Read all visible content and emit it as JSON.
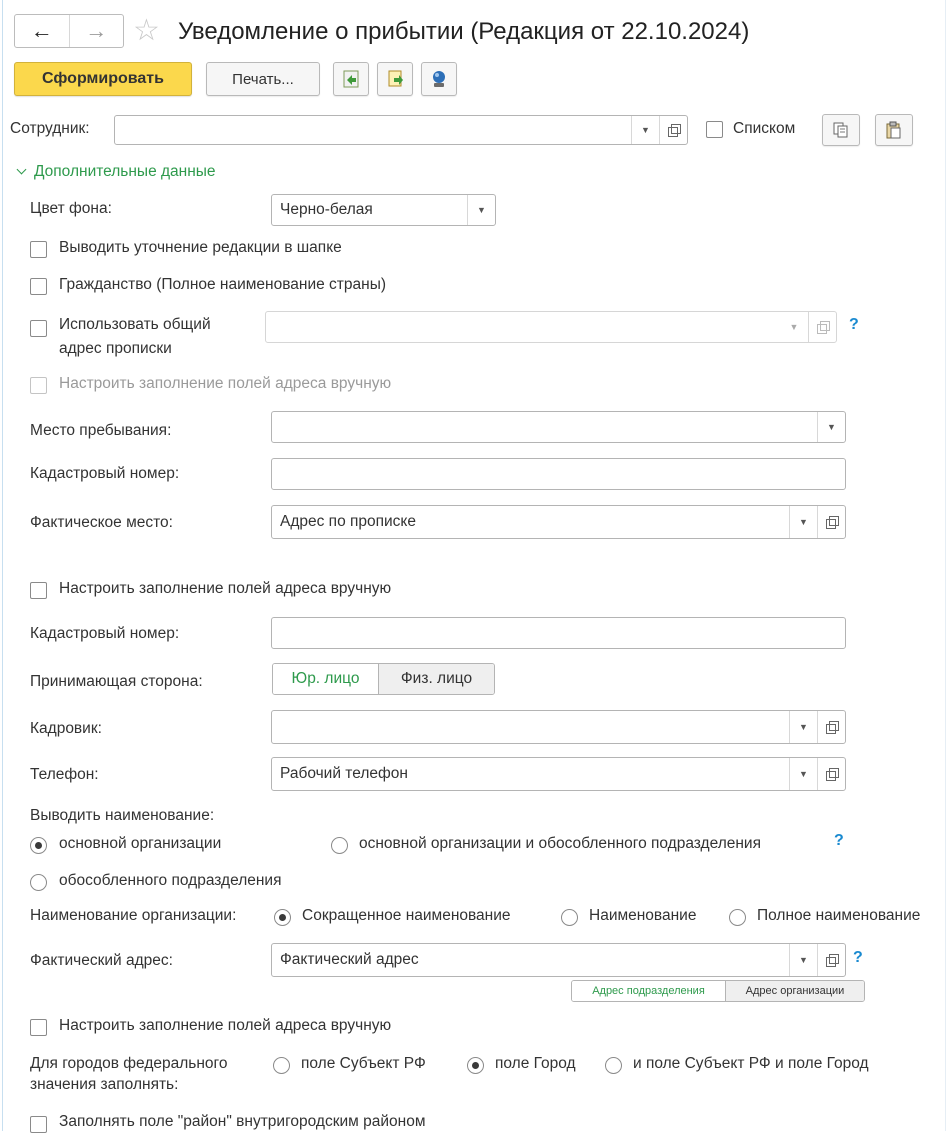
{
  "window": {
    "title": "Уведомление о прибытии (Редакция от 22.10.2024)"
  },
  "nav": {
    "back_icon": "arrow-left-icon",
    "forward_icon": "arrow-right-icon",
    "favorite_icon": "star-icon"
  },
  "toolbar": {
    "form_label": "Сформировать",
    "print_label": "Печать...",
    "icons": [
      "save-green-icon",
      "export-doc-icon",
      "settings-blue-icon"
    ]
  },
  "employee": {
    "label": "Сотрудник:",
    "value": "",
    "list_label": "Списком",
    "list_checked": false,
    "copy_icon": "copy-icon",
    "paste_icon": "paste-icon"
  },
  "extra_group": {
    "title": "Дополнительные данные",
    "expanded": true
  },
  "fields": {
    "bg_color": {
      "label": "Цвет фона:",
      "value": "Черно-белая"
    },
    "edition_in_header": {
      "label": "Выводить уточнение редакции в шапке",
      "checked": false
    },
    "citizenship_full": {
      "label": "Гражданство (Полное наименование страны)",
      "checked": false
    },
    "common_address": {
      "label_line1": "Использовать общий",
      "label_line2": "адрес прописки",
      "checked": false,
      "value": ""
    },
    "manual_address_1": {
      "label": "Настроить заполнение полей адреса вручную",
      "checked": false,
      "disabled": true
    },
    "stay_place": {
      "label": "Место пребывания:",
      "value": ""
    },
    "cadastral_1": {
      "label": "Кадастровый номер:",
      "value": ""
    },
    "actual_place": {
      "label": "Фактическое место:",
      "value": "Адрес по прописке"
    },
    "manual_address_2": {
      "label": "Настроить заполнение полей адреса вручную",
      "checked": false
    },
    "cadastral_2": {
      "label": "Кадастровый номер:",
      "value": ""
    },
    "receiving_party": {
      "label": "Принимающая сторона:",
      "options": [
        "Юр. лицо",
        "Физ. лицо"
      ],
      "selected": "Юр. лицо"
    },
    "hr_officer": {
      "label": "Кадровик:",
      "value": ""
    },
    "phone": {
      "label": "Телефон:",
      "value": "Рабочий телефон"
    },
    "output_name": {
      "label": "Выводить наименование:",
      "options": [
        "основной организации",
        "основной организации и обособленного подразделения",
        "обособленного подразделения"
      ],
      "selected": "основной организации"
    },
    "org_name": {
      "label": "Наименование организации:",
      "options": [
        "Сокращенное наименование",
        "Наименование",
        "Полное наименование"
      ],
      "selected": "Сокращенное наименование"
    },
    "actual_address": {
      "label": "Фактический адрес:",
      "value": "Фактический адрес",
      "sub_options": [
        "Адрес подразделения",
        "Адрес организации"
      ],
      "selected": "Адрес подразделения"
    },
    "manual_address_3": {
      "label": "Настроить заполнение полей адреса вручную",
      "checked": false
    },
    "federal_cities": {
      "label_line1": "Для городов федерального",
      "label_line2": "значения заполнять:",
      "options": [
        "поле Субъект РФ",
        "поле Город",
        "и поле Субъект РФ и поле Город"
      ],
      "selected": "поле Город"
    },
    "district": {
      "label": "Заполнять поле \"район\" внутригородским районом",
      "checked": false
    }
  },
  "help_mark": "?",
  "colors": {
    "primary_button": "#fbd84c",
    "accent_green": "#2e9a4c",
    "help_blue": "#1a8ad0"
  }
}
